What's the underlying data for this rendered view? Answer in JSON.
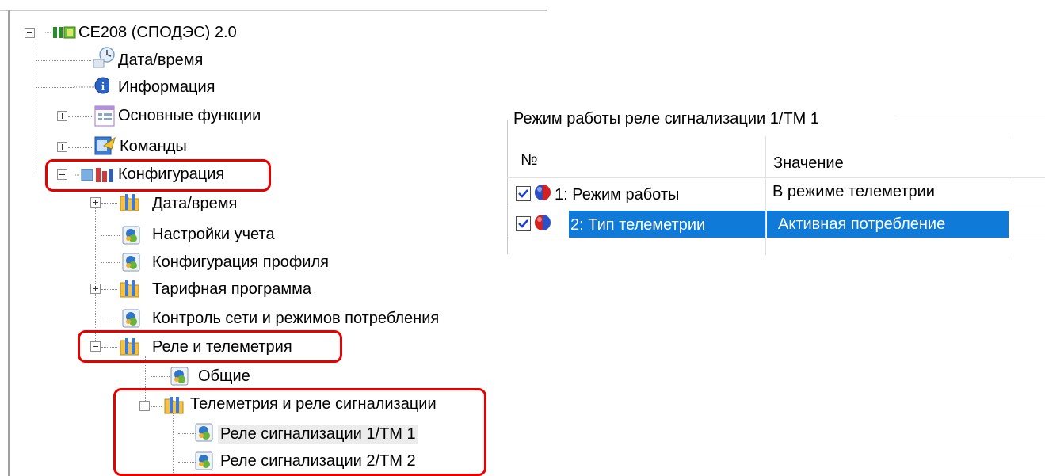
{
  "tree": {
    "root": "CE208 (СПОДЭС) 2.0",
    "items": {
      "datetime": "Дата/время",
      "info": "Информация",
      "main_functions": "Основные функции",
      "commands": "Команды",
      "configuration": "Конфигурация",
      "config_datetime": "Дата/время",
      "accounting_settings": "Настройки учета",
      "profile_config": "Конфигурация профиля",
      "tariff_program": "Тарифная программа",
      "network_control": "Контроль сети и режимов потребления",
      "relay_telemetry": "Реле и телеметрия",
      "general": "Общие",
      "telemetry_signal_relay": "Телеметрия и реле сигнализации",
      "signal_relay_1": "Реле сигнализации 1/ТМ 1",
      "signal_relay_2": "Реле сигнализации 2/ТМ 2"
    }
  },
  "properties": {
    "group_title": "Режим работы реле сигнализации 1/ТМ 1",
    "columns": {
      "number": "№",
      "value": "Значение"
    },
    "rows": [
      {
        "name": "1: Режим работы",
        "value": "В режиме телеметрии",
        "checked": true,
        "selected": false
      },
      {
        "name": "2: Тип телеметрии",
        "value": "Активная потребление",
        "checked": true,
        "selected": true
      }
    ]
  },
  "colors": {
    "highlight_box": "#e60000",
    "selection": "#0f7ad8",
    "checkmark": "#1a3fd6"
  }
}
